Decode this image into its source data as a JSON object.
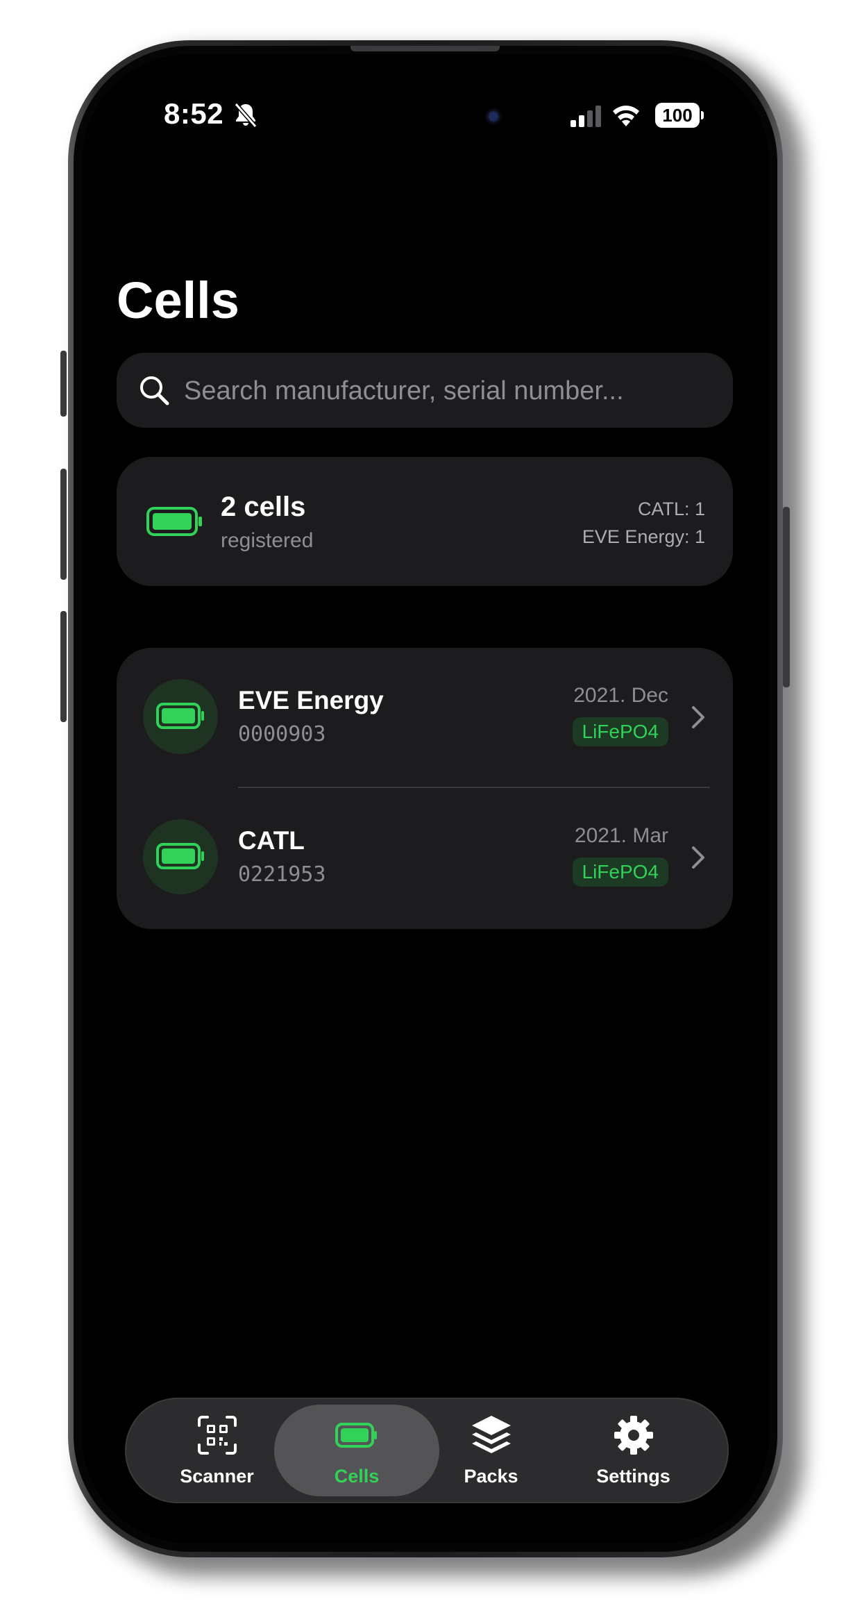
{
  "status_bar": {
    "time": "8:52",
    "battery_level": "100",
    "icons": [
      "bell-slash-icon",
      "signal-icon",
      "wifi-icon",
      "battery-icon"
    ]
  },
  "page": {
    "title": "Cells"
  },
  "search": {
    "placeholder": "Search manufacturer, serial number..."
  },
  "summary": {
    "count": "2 cells",
    "subtitle": "registered",
    "breakdown": [
      "CATL: 1",
      "EVE Energy: 1"
    ]
  },
  "cells": [
    {
      "manufacturer": "EVE Energy",
      "serial": "0000903",
      "date": "2021. Dec",
      "chemistry": "LiFePO4"
    },
    {
      "manufacturer": "CATL",
      "serial": "0221953",
      "date": "2021. Mar",
      "chemistry": "LiFePO4"
    }
  ],
  "tab_bar": {
    "tabs": [
      {
        "label": "Scanner",
        "icon": "qr-scanner-icon",
        "selected": false
      },
      {
        "label": "Cells",
        "icon": "battery-icon",
        "selected": true
      },
      {
        "label": "Packs",
        "icon": "stack-icon",
        "selected": false
      },
      {
        "label": "Settings",
        "icon": "gear-icon",
        "selected": false
      }
    ]
  },
  "colors": {
    "accent_green": "#32d158",
    "background": "#000000",
    "card": "#1c1c1e",
    "secondary_text": "#8e8e93"
  }
}
